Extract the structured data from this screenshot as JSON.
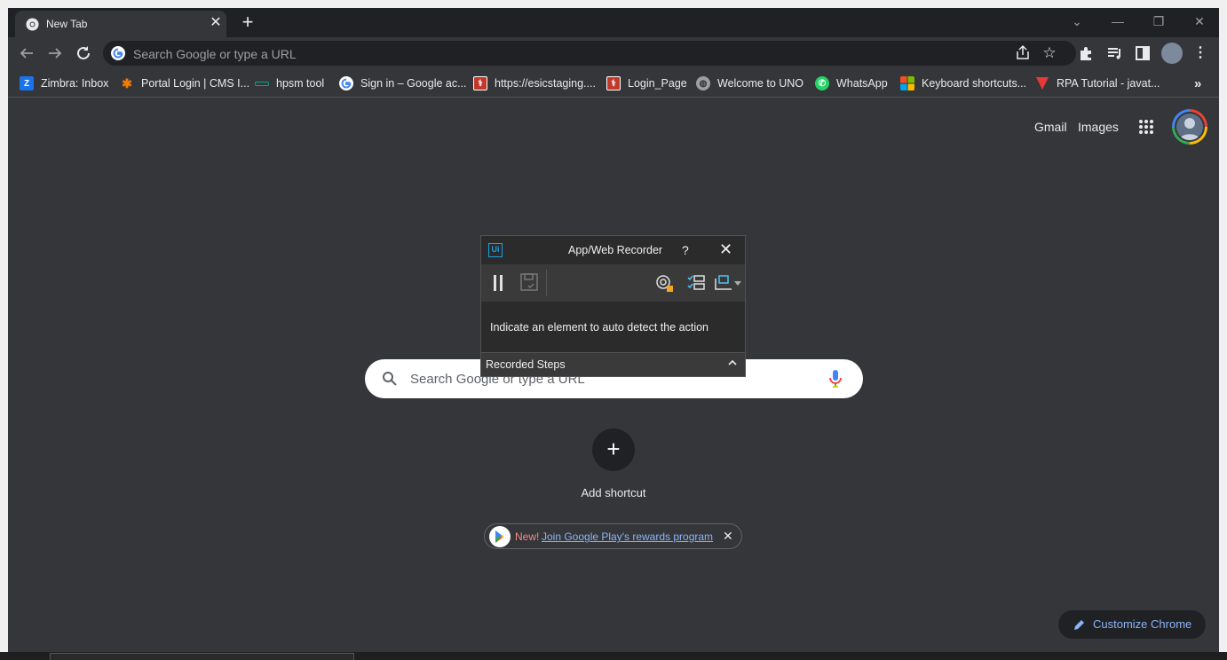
{
  "tab": {
    "title": "New Tab",
    "close": "✕"
  },
  "new_tab": "+",
  "window_controls": [
    "⌄",
    "—",
    "❐",
    "✕"
  ],
  "omnibox": {
    "placeholder": "Search Google or type a URL"
  },
  "bookmarks": [
    {
      "label": "Zimbra: Inbox",
      "icon": "zimbra-icon",
      "color": "#1a73e8"
    },
    {
      "label": "Portal Login | CMS I...",
      "icon": "portal-icon",
      "color": "#f57c00"
    },
    {
      "label": "hpsm tool",
      "icon": "hpsm-icon",
      "color": "#00a88f"
    },
    {
      "label": "Sign in – Google ac...",
      "icon": "google-icon",
      "color": "#ffffff"
    },
    {
      "label": "https://esicstaging....",
      "icon": "esic-icon",
      "color": "#c0392b"
    },
    {
      "label": "Login_Page",
      "icon": "esic-icon",
      "color": "#c0392b"
    },
    {
      "label": "Welcome to UNO",
      "icon": "globe-icon",
      "color": "#9aa0a6"
    },
    {
      "label": "WhatsApp",
      "icon": "whatsapp-icon",
      "color": "#25d366"
    },
    {
      "label": "Keyboard shortcuts...",
      "icon": "microsoft-icon",
      "color": "#f25022"
    },
    {
      "label": "RPA Tutorial - javat...",
      "icon": "javatpoint-icon",
      "color": "#e53935"
    }
  ],
  "bookmarks_more": "»",
  "page": {
    "gmail": "Gmail",
    "images": "Images",
    "search_placeholder": "Search Google or type a URL",
    "add_shortcut": "Add shortcut",
    "promo_new": "New!",
    "promo_link": "Join Google Play's rewards program",
    "customize": "Customize Chrome"
  },
  "recorder": {
    "logo": "Ui",
    "title": "App/Web Recorder",
    "help": "?",
    "close": "✕",
    "message": "Indicate an element to auto detect the action",
    "steps_label": "Recorded Steps"
  }
}
